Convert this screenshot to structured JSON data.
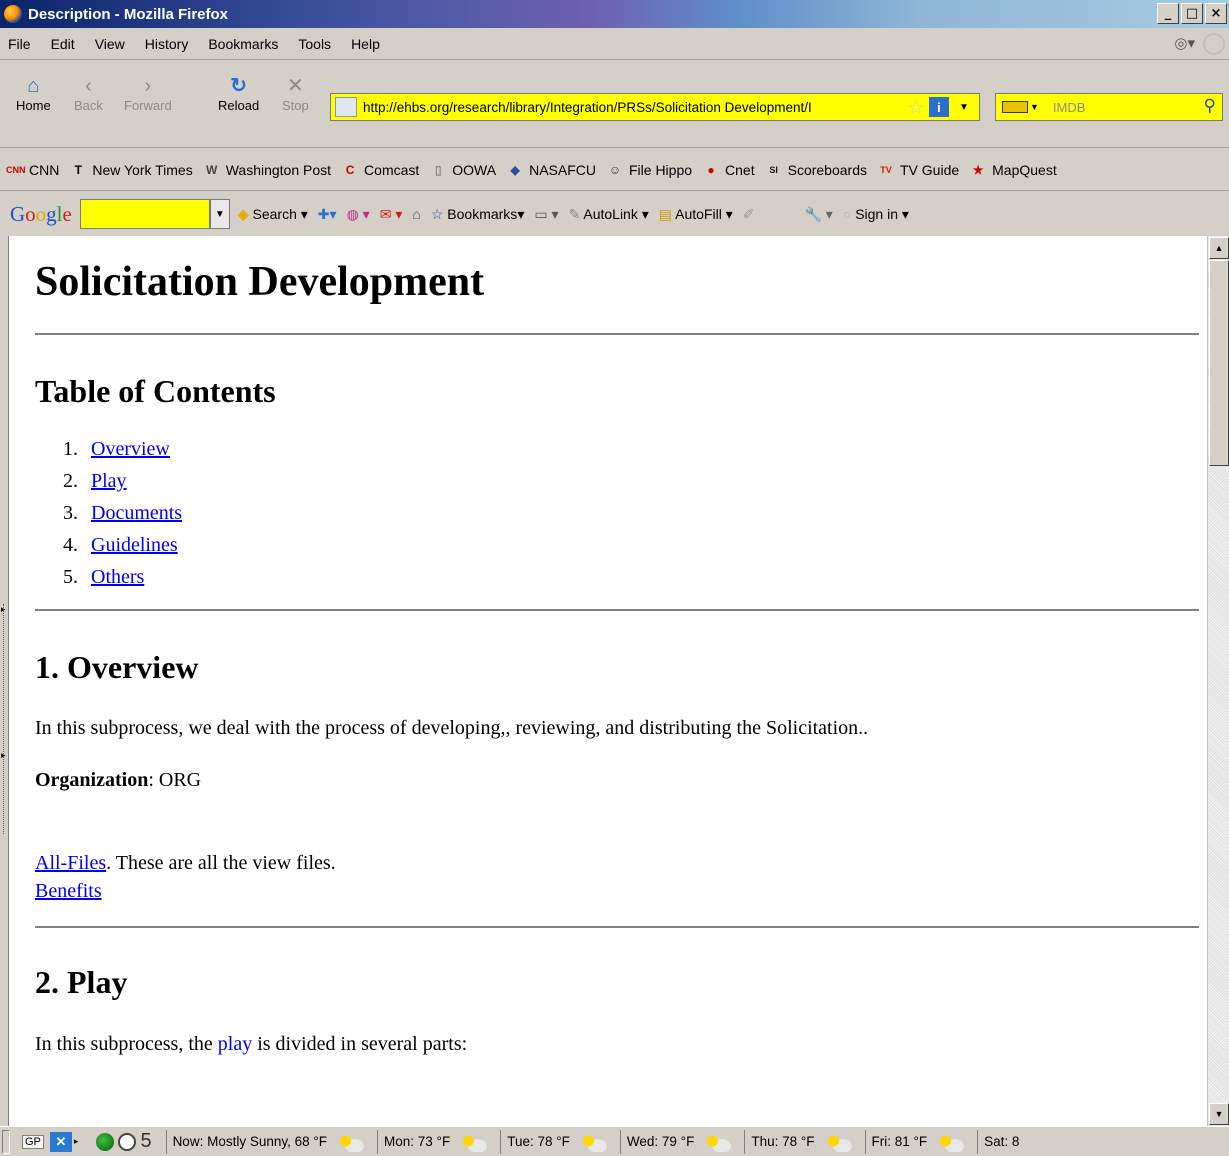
{
  "window": {
    "title": "Description - Mozilla Firefox",
    "controls": [
      "_",
      "□",
      "×"
    ]
  },
  "menu": [
    "File",
    "Edit",
    "View",
    "History",
    "Bookmarks",
    "Tools",
    "Help"
  ],
  "nav": {
    "home": "Home",
    "back": "Back",
    "forward": "Forward",
    "reload": "Reload",
    "stop": "Stop",
    "url": "http://ehbs.org/research/library/Integration/PRSs/Solicitation Development/I",
    "search_placeholder": "IMDB"
  },
  "bookmarks": [
    {
      "label": "CNN",
      "icon": "cnn-icon",
      "glyph": "CNN",
      "color": "#cc0000"
    },
    {
      "label": "New York Times",
      "icon": "nyt-icon",
      "glyph": "T",
      "color": "#000000"
    },
    {
      "label": "Washington Post",
      "icon": "wapo-icon",
      "glyph": "W",
      "color": "#444444"
    },
    {
      "label": "Comcast",
      "icon": "comcast-icon",
      "glyph": "C",
      "color": "#cc0000"
    },
    {
      "label": "OOWA",
      "icon": "page-icon",
      "glyph": "▯",
      "color": "#888888"
    },
    {
      "label": "NASAFCU",
      "icon": "nasafcu-icon",
      "glyph": "◆",
      "color": "#2a4ea0"
    },
    {
      "label": "File Hippo",
      "icon": "filehippo-icon",
      "glyph": "☺",
      "color": "#333333"
    },
    {
      "label": "Cnet",
      "icon": "cnet-icon",
      "glyph": "●",
      "color": "#cc0000"
    },
    {
      "label": "Scoreboards",
      "icon": "si-icon",
      "glyph": "SI",
      "color": "#1a1a1a"
    },
    {
      "label": "TV Guide",
      "icon": "tvguide-icon",
      "glyph": "TV",
      "color": "#cc2200"
    },
    {
      "label": "MapQuest",
      "icon": "mapquest-icon",
      "glyph": "★",
      "color": "#cc0000"
    }
  ],
  "google_toolbar": {
    "logo": "Google",
    "search": "Search",
    "bookmarks": "Bookmarks",
    "autolink": "AutoLink",
    "autofill": "AutoFill",
    "signin": "Sign in"
  },
  "page": {
    "title": "Solicitation Development",
    "toc_heading": "Table of Contents",
    "toc": [
      {
        "num": "1.",
        "label": "Overview"
      },
      {
        "num": "2.",
        "label": "Play"
      },
      {
        "num": "3.",
        "label": "Documents"
      },
      {
        "num": "4.",
        "label": "Guidelines"
      },
      {
        "num": "5.",
        "label": "Others"
      }
    ],
    "overview_heading": "1. Overview",
    "overview_text": "In this subprocess, we deal with the process of developing,, reviewing, and distributing the Solicitation..",
    "org_label": "Organization",
    "org_value": ": ORG",
    "allfiles_link": "All-Files",
    "allfiles_text": ". These are all the view files.",
    "benefits_link": "Benefits",
    "play_heading": "2. Play",
    "play_text_before": "In this subprocess, the ",
    "play_link": "play",
    "play_text_after": " is divided in several parts:"
  },
  "status": {
    "gp": "GP",
    "count": "5",
    "weather": [
      "Now: Mostly Sunny, 68 °F",
      "Mon: 73 °F",
      "Tue: 78 °F",
      "Wed: 79 °F",
      "Thu: 78 °F",
      "Fri: 81 °F",
      "Sat: 8"
    ]
  }
}
